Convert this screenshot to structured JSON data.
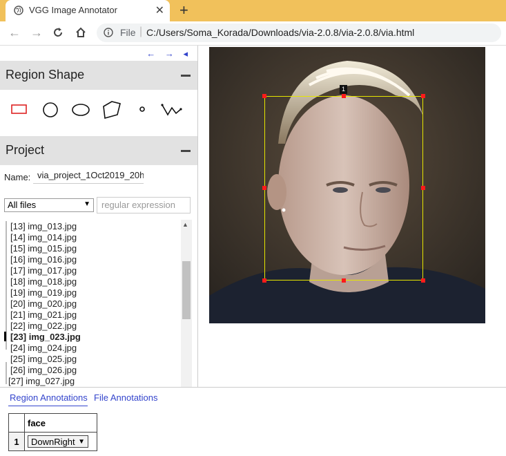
{
  "browser": {
    "tab_title": "VGG Image Annotator",
    "address_file_label": "File",
    "address_url": "C:/Users/Soma_Korada/Downloads/via-2.0.8/via-2.0.8/via.html"
  },
  "nav_arrows": {
    "prev": "←",
    "next": "→",
    "collapse": "◂"
  },
  "region_shape": {
    "title": "Region Shape",
    "shapes": [
      "rectangle",
      "circle",
      "ellipse",
      "polygon",
      "point",
      "polyline"
    ],
    "active_shape": "rectangle"
  },
  "project": {
    "title": "Project",
    "name_label": "Name:",
    "name_value": "via_project_1Oct2019_20h",
    "filter_selected": "All files",
    "regex_placeholder": "regular expression",
    "files": [
      "[13] img_013.jpg",
      "[14] img_014.jpg",
      "[15] img_015.jpg",
      "[16] img_016.jpg",
      "[17] img_017.jpg",
      "[18] img_018.jpg",
      "[19] img_019.jpg",
      "[20] img_020.jpg",
      "[21] img_021.jpg",
      "[22] img_022.jpg",
      "[23] img_023.jpg",
      "[24] img_024.jpg",
      "[25] img_025.jpg",
      "[26] img_026.jpg",
      "[27] img_027.jpg"
    ],
    "current_file_index": 10
  },
  "canvas": {
    "region_label": "1",
    "box_color": "#e6e600",
    "handle_color": "#ff1a1a"
  },
  "annotations": {
    "tab_region": "Region Annotations",
    "tab_file": "File Annotations",
    "column_header": "face",
    "row_index": "1",
    "row_value": "DownRight"
  },
  "colors": {
    "tabbar": "#f1c15b",
    "accent": "#3344cc",
    "section_bg": "#e2e2e2"
  }
}
